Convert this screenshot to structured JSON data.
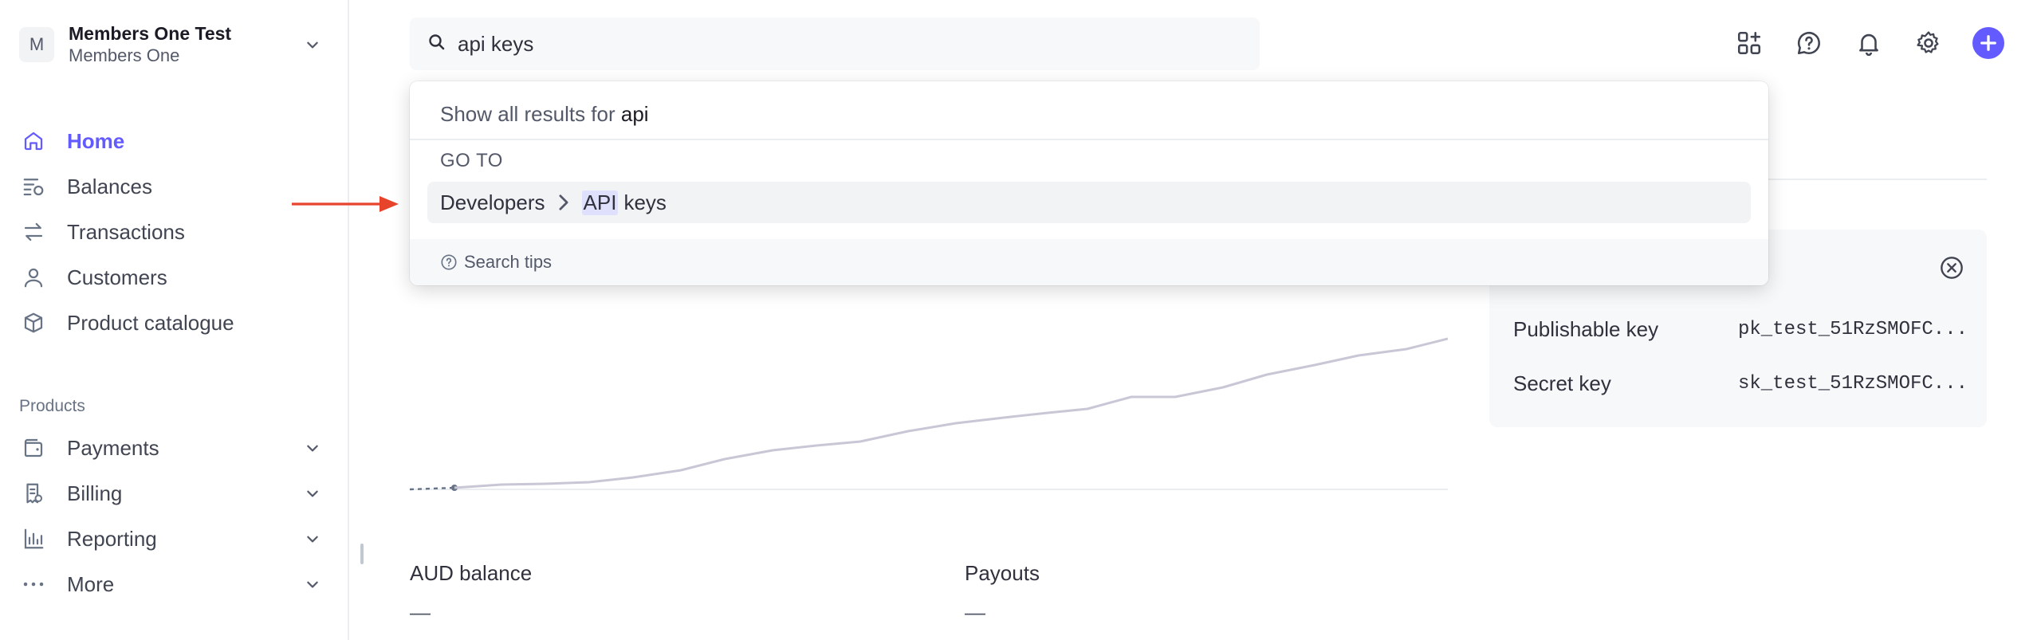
{
  "account": {
    "avatar_letter": "M",
    "name": "Members One Test",
    "sub": "Members One"
  },
  "nav": {
    "home": "Home",
    "balances": "Balances",
    "transactions": "Transactions",
    "customers": "Customers",
    "catalogue": "Product catalogue",
    "products_section": "Products",
    "payments": "Payments",
    "billing": "Billing",
    "reporting": "Reporting",
    "more": "More"
  },
  "search": {
    "value": "api keys"
  },
  "dropdown": {
    "show_all_prefix": "Show all results for",
    "show_all_query": "api",
    "goto_heading": "GO TO",
    "result_parent": "Developers",
    "result_highlight": "API",
    "result_rest": "keys",
    "tips": "Search tips"
  },
  "keys_card": {
    "publishable_label": "Publishable key",
    "publishable_value": "pk_test_51RzSMOFC...",
    "secret_label": "Secret key",
    "secret_value": "sk_test_51RzSMOFC..."
  },
  "stats": {
    "aud_label": "AUD balance",
    "aud_value": "—",
    "payouts_label": "Payouts",
    "payouts_value": "—"
  },
  "colors": {
    "accent": "#635bff",
    "arrow": "#e8432b",
    "line": "#c9c7d6"
  },
  "icons": [
    "search-icon",
    "apps-add-icon",
    "help-icon",
    "bell-icon",
    "gear-icon",
    "plus-icon",
    "home-icon",
    "balances-icon",
    "transactions-icon",
    "customers-icon",
    "catalogue-icon",
    "wallet-icon",
    "billing-icon",
    "reporting-icon",
    "more-icon",
    "close-circle-icon"
  ]
}
